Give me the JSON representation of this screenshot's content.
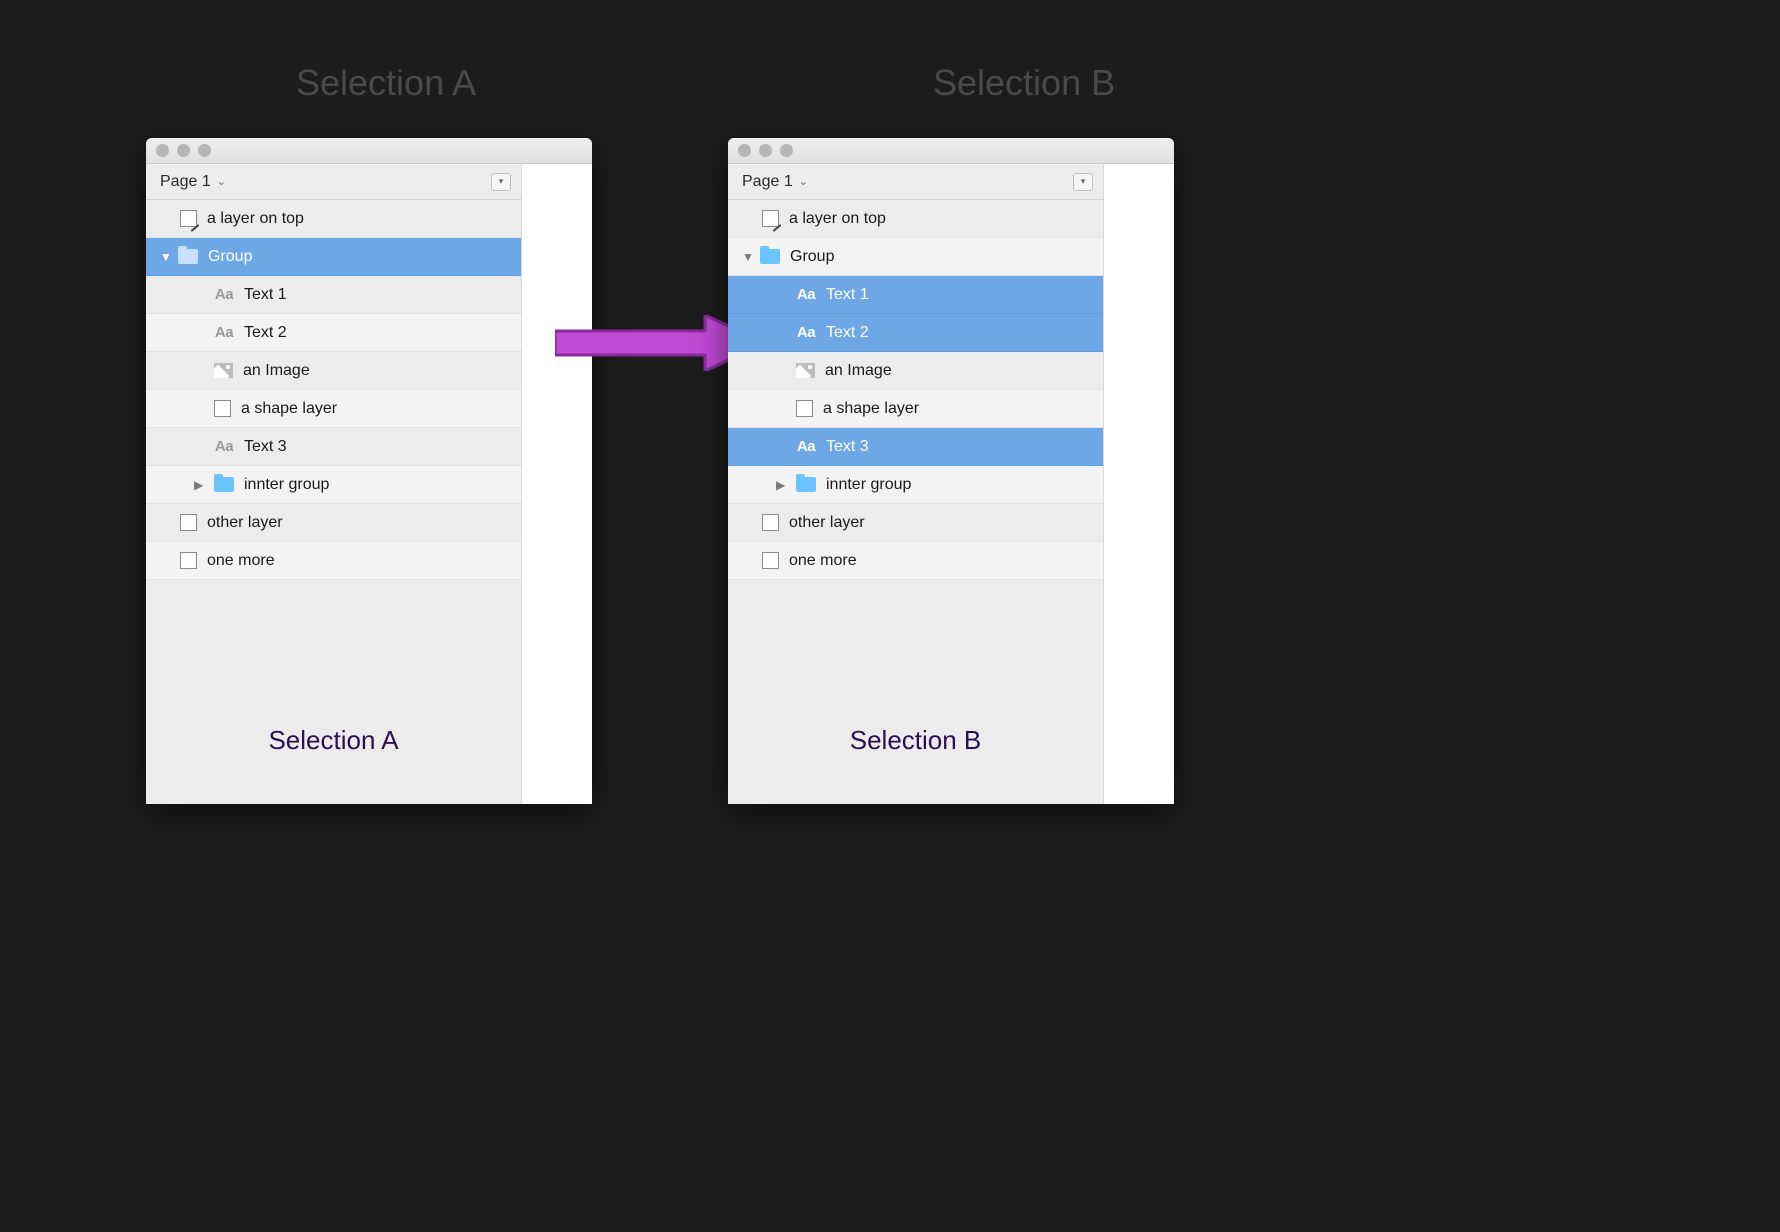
{
  "headings": {
    "left": "Selection A",
    "right": "Selection B"
  },
  "captions": {
    "left": "Selection A",
    "right": "Selection B"
  },
  "page_selector": {
    "label": "Page 1"
  },
  "colors": {
    "selection": "#6ea7e6",
    "arrow_fill": "#c24bd6",
    "arrow_stroke": "#8b2aa0",
    "folder": "#6bc3ff",
    "caption": "#2a0f52"
  },
  "panel_a": {
    "layers": [
      {
        "label": "a layer on top",
        "icon": "pen",
        "depth": 0,
        "selected": false,
        "expanded": null
      },
      {
        "label": "Group",
        "icon": "folder",
        "depth": 1,
        "selected": true,
        "expanded": true
      },
      {
        "label": "Text 1",
        "icon": "text",
        "depth": 2,
        "selected": false,
        "expanded": null
      },
      {
        "label": "Text 2",
        "icon": "text",
        "depth": 2,
        "selected": false,
        "expanded": null
      },
      {
        "label": "an Image",
        "icon": "image",
        "depth": 2,
        "selected": false,
        "expanded": null
      },
      {
        "label": "a shape layer",
        "icon": "shape",
        "depth": 2,
        "selected": false,
        "expanded": null
      },
      {
        "label": "Text 3",
        "icon": "text",
        "depth": 2,
        "selected": false,
        "expanded": null
      },
      {
        "label": "innter group",
        "icon": "folder",
        "depth": 2,
        "selected": false,
        "expanded": false
      },
      {
        "label": "other layer",
        "icon": "shape",
        "depth": 0,
        "selected": false,
        "expanded": null
      },
      {
        "label": "one more",
        "icon": "shape",
        "depth": 0,
        "selected": false,
        "expanded": null
      }
    ]
  },
  "panel_b": {
    "layers": [
      {
        "label": "a layer on top",
        "icon": "pen",
        "depth": 0,
        "selected": false,
        "expanded": null
      },
      {
        "label": "Group",
        "icon": "folder",
        "depth": 1,
        "selected": false,
        "expanded": true
      },
      {
        "label": "Text 1",
        "icon": "text",
        "depth": 2,
        "selected": true,
        "expanded": null
      },
      {
        "label": "Text 2",
        "icon": "text",
        "depth": 2,
        "selected": true,
        "expanded": null
      },
      {
        "label": "an Image",
        "icon": "image",
        "depth": 2,
        "selected": false,
        "expanded": null
      },
      {
        "label": "a shape layer",
        "icon": "shape",
        "depth": 2,
        "selected": false,
        "expanded": null
      },
      {
        "label": "Text 3",
        "icon": "text",
        "depth": 2,
        "selected": true,
        "expanded": null
      },
      {
        "label": "innter group",
        "icon": "folder",
        "depth": 2,
        "selected": false,
        "expanded": false
      },
      {
        "label": "other layer",
        "icon": "shape",
        "depth": 0,
        "selected": false,
        "expanded": null
      },
      {
        "label": "one more",
        "icon": "shape",
        "depth": 0,
        "selected": false,
        "expanded": null
      }
    ]
  }
}
